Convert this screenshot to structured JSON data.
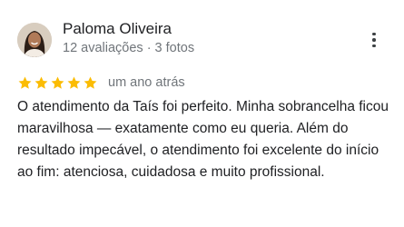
{
  "reviewer": {
    "name": "Paloma Oliveira",
    "meta": "12 avaliações · 3 fotos"
  },
  "rating": {
    "value": 5,
    "max": 5,
    "star_color": "#fbbc04",
    "date": "um ano atrás"
  },
  "review": {
    "text": "O atendimento da Taís foi perfeito. Minha sobrancelha ficou maravilhosa — exatamente como eu queria. Além do resultado impecável, o atendimento foi excelente do início ao fim: atenciosa, cuidadosa e muito profissional."
  },
  "icons": {
    "avatar": "avatar",
    "menu": "more-vert-icon",
    "star": "star-icon"
  }
}
